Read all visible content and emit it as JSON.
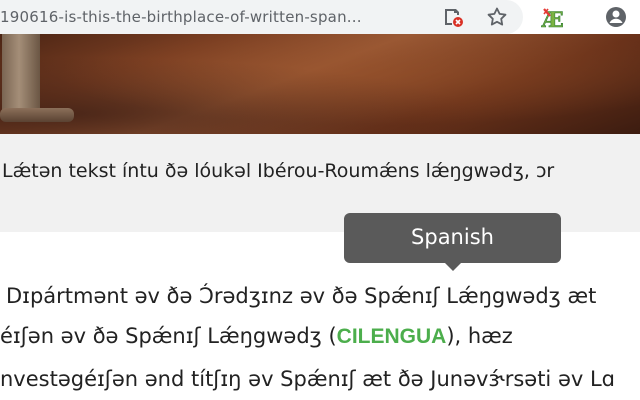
{
  "browser": {
    "url": "190616-is-this-the-birthplace-of-written-span...",
    "icons": [
      "blocked-content-icon",
      "star-icon",
      "extension-ae-icon",
      "account-icon"
    ],
    "extension_label": "Æ"
  },
  "article": {
    "caption": "Lǽtən tekst íntu ðə lóukəl Ibérou-Roumǽns lǽŋgwədʒ, ɔr",
    "line1": "Dɪpártmənt əv ðə Ɔ́rədʒɪnz əv ðə Spǽnɪʃ Lǽŋgwədʒ æt",
    "line2_pre": "éɪʃən əv ðə Spǽnɪʃ Lǽŋgwədʒ (",
    "line2_link": "CILENGUA",
    "line2_post": "), hæz",
    "line3": "nvestəgéɪʃən ənd títʃɪŋ əv Spǽnɪʃ æt ðə Junəvɝ́rsəti əv Lɑ"
  },
  "tooltip": {
    "text": "Spanish"
  },
  "colors": {
    "accent_green": "#4cae4c",
    "tooltip_bg": "#5a5a5a"
  }
}
